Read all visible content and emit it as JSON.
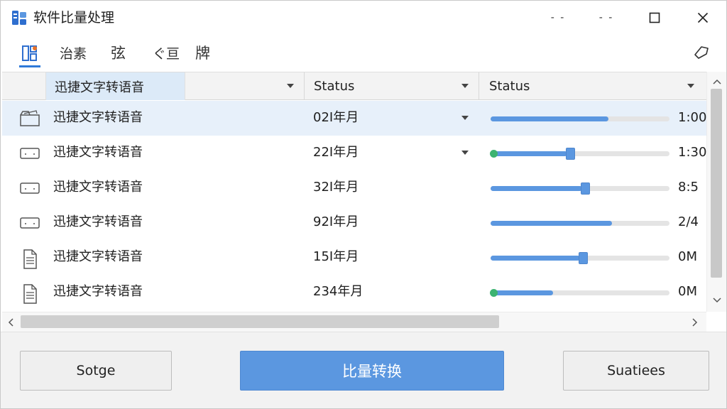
{
  "window": {
    "title": "软件比量处理",
    "controls": {
      "min1": "- -",
      "min2": "- -"
    }
  },
  "toolbar": {
    "items": [
      "",
      "治素",
      "弦",
      "",
      "牌"
    ],
    "label3": "ぐ亘"
  },
  "table": {
    "columns": [
      "迅捷文字转语音",
      "Status",
      "Status"
    ],
    "rows": [
      {
        "icon": "folder-icon",
        "name": "迅捷文字转语音",
        "date": "02I年月",
        "caret": true,
        "progress": 0.66,
        "thumb": false,
        "dot": false,
        "time": "1:00",
        "selected": true
      },
      {
        "icon": "drive-icon",
        "name": "迅捷文字转语音",
        "date": "22I年月",
        "caret": true,
        "progress": 0.43,
        "thumb": true,
        "dot": true,
        "time": "1:30",
        "selected": false
      },
      {
        "icon": "drive-icon",
        "name": "迅捷文字转语音",
        "date": "32I年月",
        "caret": false,
        "progress": 0.51,
        "thumb": true,
        "dot": false,
        "time": "8:5",
        "selected": false
      },
      {
        "icon": "drive-icon",
        "name": "迅捷文字转语音",
        "date": "92I年月",
        "caret": false,
        "progress": 0.68,
        "thumb": false,
        "dot": false,
        "time": "2/4",
        "selected": false
      },
      {
        "icon": "document-icon",
        "name": "迅捷文字转语音",
        "date": "15I年月",
        "caret": false,
        "progress": 0.5,
        "thumb": true,
        "dot": false,
        "time": "0M",
        "selected": false
      },
      {
        "icon": "document-icon",
        "name": "迅捷文字转语音",
        "date": "234年月",
        "caret": false,
        "progress": 0.35,
        "thumb": false,
        "dot": true,
        "time": "0M",
        "selected": false
      }
    ]
  },
  "footer": {
    "left_button": "Sotge",
    "primary_button": "比量转换",
    "right_button": "Suatiees"
  },
  "colors": {
    "accent": "#5b97e0",
    "selected_row": "#e7f0fa",
    "status_dot": "#3cb371"
  }
}
